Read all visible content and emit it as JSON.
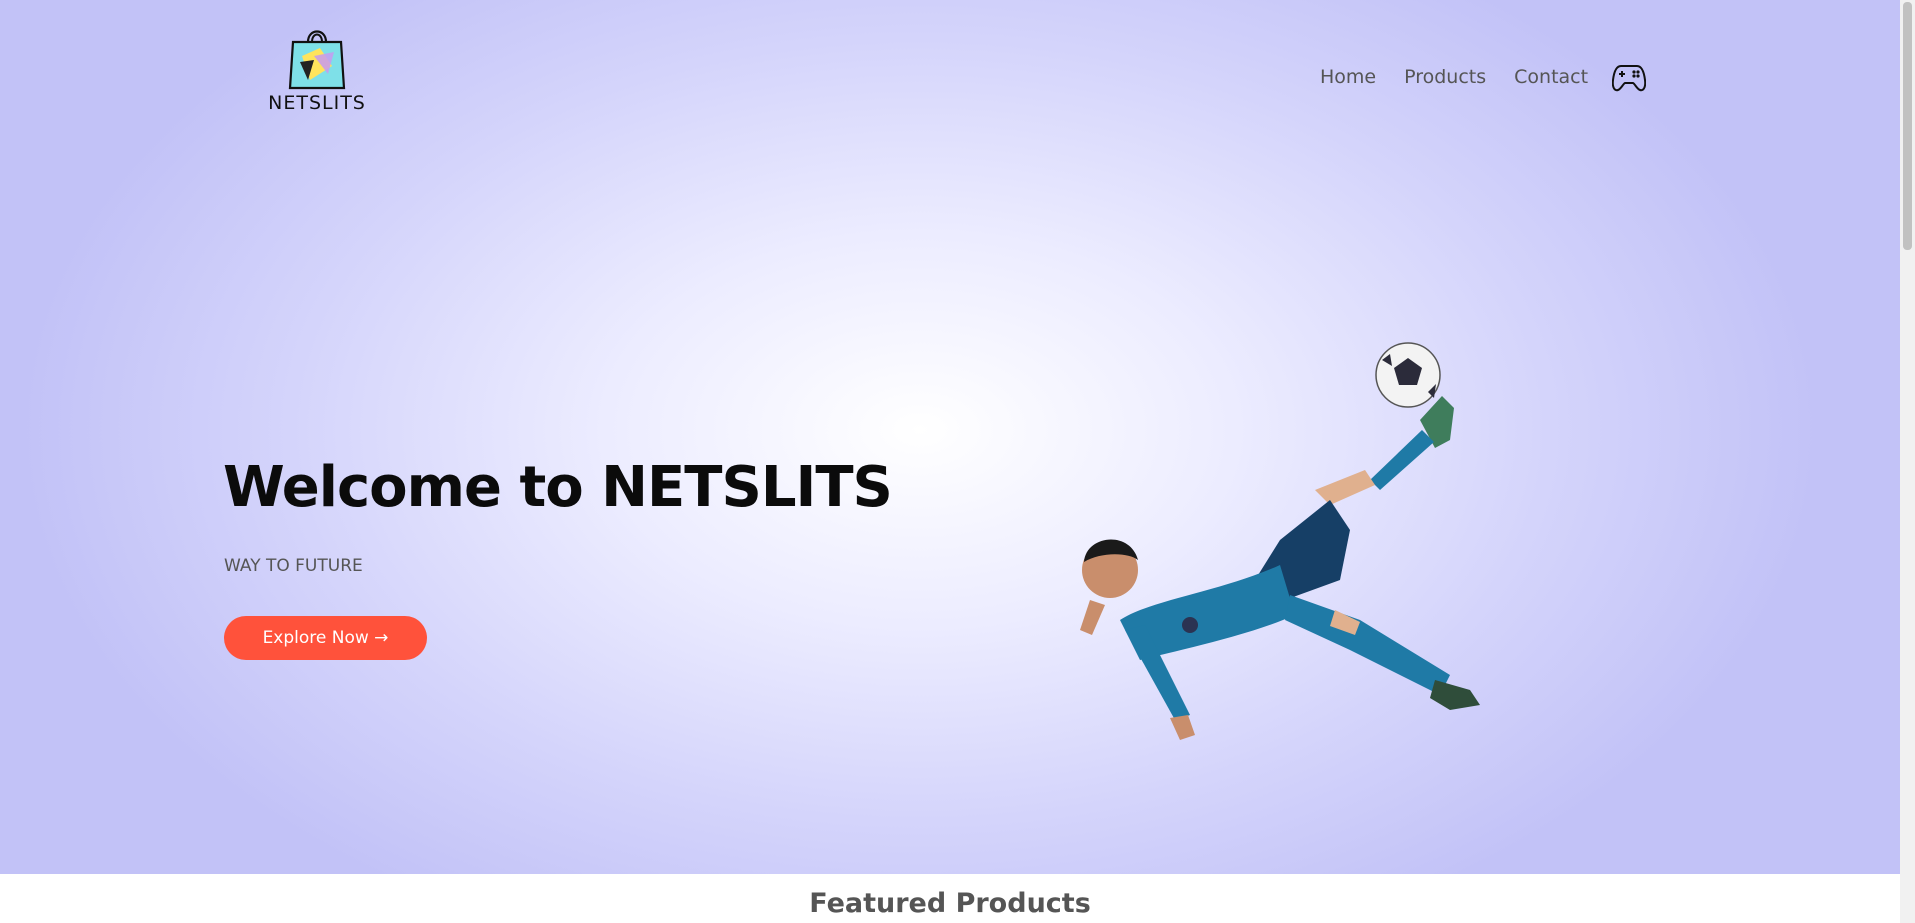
{
  "brand": {
    "name": "NETSLITS"
  },
  "nav": {
    "items": [
      "Home",
      "Products",
      "Contact"
    ]
  },
  "hero": {
    "title": "Welcome to NETSLITS",
    "subtitle": "WAY TO FUTURE",
    "cta_label": "Explore Now →",
    "image_subject": "footballer performing a bicycle kick with a ball"
  },
  "featured": {
    "title": "Featured Products"
  },
  "colors": {
    "accent": "#ff523b",
    "hero_edge": "#c2c2f7",
    "hero_center": "#ffffff",
    "jersey": "#1f7aa6"
  },
  "icons": [
    "shopping-bag-logo-icon",
    "gamepad-icon"
  ]
}
